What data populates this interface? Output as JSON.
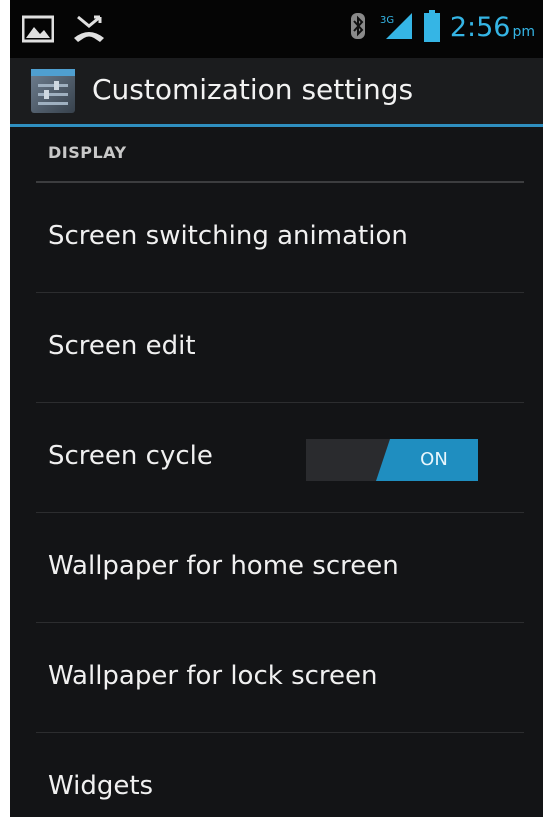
{
  "status_bar": {
    "time": "2:56",
    "ampm": "pm",
    "network_type": "3G"
  },
  "action_bar": {
    "title": "Customization settings"
  },
  "settings": {
    "section_header": "DISPLAY",
    "items": [
      {
        "label": "Screen switching animation"
      },
      {
        "label": "Screen edit"
      },
      {
        "label": "Screen cycle",
        "toggle": "ON"
      },
      {
        "label": "Wallpaper for home screen"
      },
      {
        "label": "Wallpaper for lock screen"
      },
      {
        "label": "Widgets"
      }
    ]
  },
  "colors": {
    "accent": "#35b5e5",
    "toggle_on": "#1f8ec0",
    "background": "#131416"
  },
  "icons": [
    "gallery-icon",
    "missed-call-icon",
    "bluetooth-icon",
    "signal-icon",
    "battery-icon",
    "app-settings-icon"
  ]
}
